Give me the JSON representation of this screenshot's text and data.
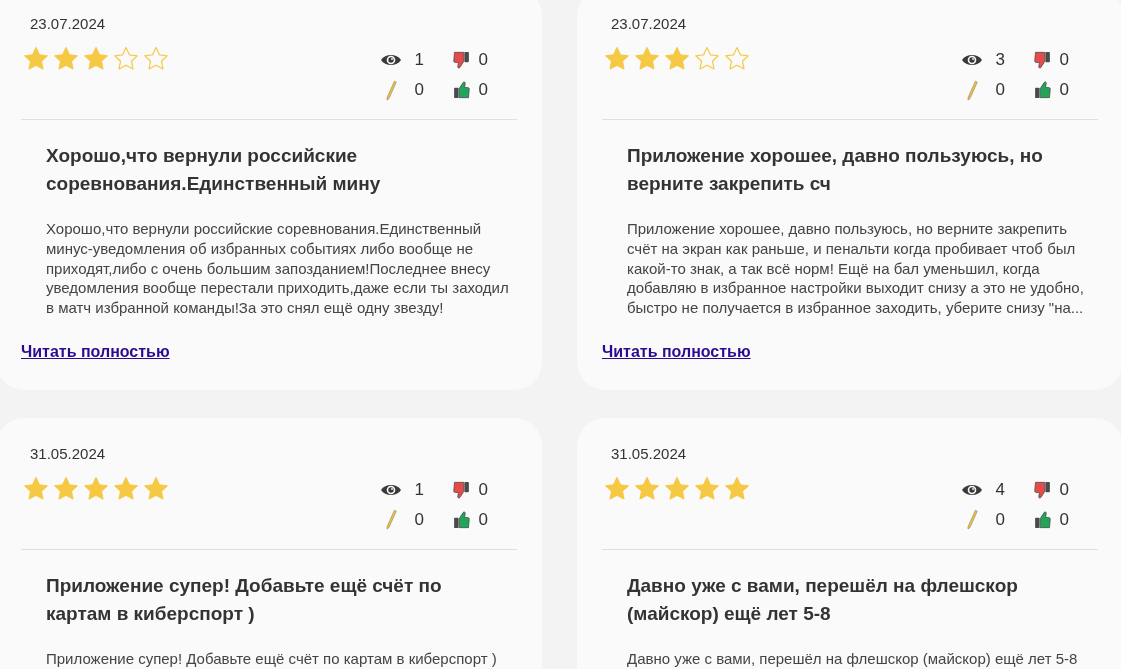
{
  "reviews": [
    {
      "date": "23.07.2024",
      "stars": 3,
      "stats": [
        {
          "kind": "views",
          "value": "1"
        },
        {
          "kind": "dislikes",
          "value": "0"
        },
        {
          "kind": "edits",
          "value": "0"
        },
        {
          "kind": "likes",
          "value": "0"
        }
      ],
      "title": "Хорошо,что вернули российские соревнования.Единственный мину",
      "text": "Хорошо,что вернули российские соревнования.Единственный минус-уведомления об избранных событиях либо вообще не приходят,либо с очень большим запозданием!Последнее внесу уведомления вообще перестали приходить,даже если ты заходил в матч избранной команды!За это снял ещё одну звезду!",
      "link": "Читать полностью"
    },
    {
      "date": "23.07.2024",
      "stars": 3,
      "stats": [
        {
          "kind": "views",
          "value": "3"
        },
        {
          "kind": "dislikes",
          "value": "0"
        },
        {
          "kind": "edits",
          "value": "0"
        },
        {
          "kind": "likes",
          "value": "0"
        }
      ],
      "title": "Приложение хорошее, давно пользуюсь, но верните закрепить сч",
      "text": "Приложение хорошее, давно пользуюсь, но верните закрепить счёт на экран как раньше, и пенальти когда пробивает чтоб был какой-то знак, а так всё норм! Ещё на бал уменьшил, когда добавляю в избранное настройки выходит снизу а это не удобно, быстро не получается в избранное заходить, уберите снизу \"на...",
      "link": "Читать полностью"
    },
    {
      "date": "31.05.2024",
      "stars": 5,
      "stats": [
        {
          "kind": "views",
          "value": "1"
        },
        {
          "kind": "dislikes",
          "value": "0"
        },
        {
          "kind": "edits",
          "value": "0"
        },
        {
          "kind": "likes",
          "value": "0"
        }
      ],
      "title": "Приложение супер! Добавьте ещё счёт по картам в киберспорт )",
      "text": "Приложение супер! Добавьте ещё счёт по картам в киберспорт )"
    },
    {
      "date": "31.05.2024",
      "stars": 5,
      "stats": [
        {
          "kind": "views",
          "value": "4"
        },
        {
          "kind": "dislikes",
          "value": "0"
        },
        {
          "kind": "edits",
          "value": "0"
        },
        {
          "kind": "likes",
          "value": "0"
        }
      ],
      "title": "Давно уже с вами, перешёл на флешскор (майскор) ещё лет 5-8",
      "text": "Давно уже с вами, перешёл на флешскор (майскор) ещё лет 5-8"
    }
  ]
}
